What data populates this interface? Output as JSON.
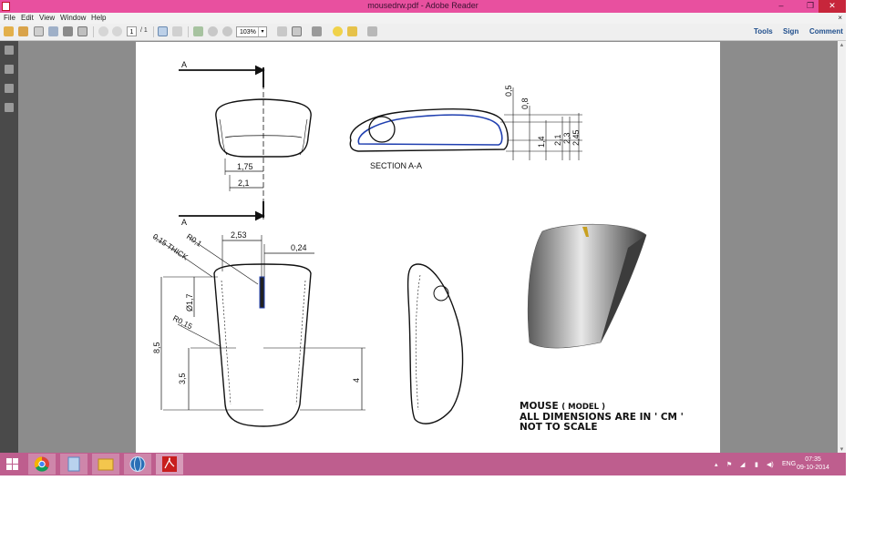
{
  "window": {
    "title": "mousedrw.pdf - Adobe Reader",
    "min": "–",
    "max": "❐",
    "close": "✕"
  },
  "menu": {
    "items": [
      "File",
      "Edit",
      "View",
      "Window",
      "Help"
    ],
    "doc_close": "×"
  },
  "toolbar": {
    "page": "1",
    "page_total": "/ 1",
    "zoom": "103%",
    "zoom_arrow": "▾",
    "links": [
      "Tools",
      "Sign",
      "Comment"
    ]
  },
  "drawing": {
    "labels": {
      "section_arrow_top": "A",
      "section_arrow_bottom": "A",
      "section_caption": "SECTION  A-A",
      "dim_175": "1,75",
      "dim_21_front": "2,1",
      "dim_05": "0,5",
      "dim_08": "0,8",
      "dim_14": "1,4",
      "dim_21_side": "2,1",
      "dim_23": "2,3",
      "dim_245": "2,45",
      "dim_253": "2,53",
      "dim_024": "0,24",
      "thick": "0,15   THICK",
      "r01": "R0,1",
      "dia17": "Ø1,7",
      "r015": "R0,15",
      "dim_85": "8,5",
      "dim_35": "3,5",
      "dim_4": "4"
    },
    "note": {
      "line1_a": "MOUSE",
      "line1_b": "( MODEL )",
      "line2": "ALL DIMENSIONS ARE IN ' CM '",
      "line3": "NOT TO SCALE"
    }
  },
  "taskbar": {
    "lang": "ENG",
    "time": "07:35",
    "date": "09-10-2014",
    "arrow": "▴"
  },
  "colors": {
    "titlebar": "#e8509f",
    "taskbar": "#be5e8e",
    "accent_blue": "#1f3fb0"
  }
}
